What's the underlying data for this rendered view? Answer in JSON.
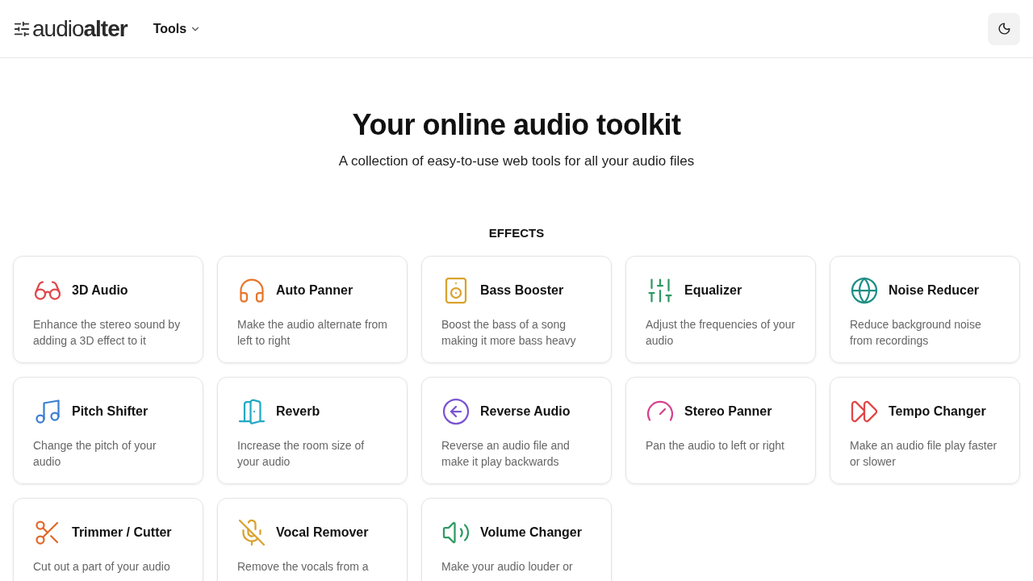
{
  "header": {
    "logo": {
      "light": "audio",
      "bold": "alter"
    },
    "nav": [
      {
        "label": "Tools",
        "expanded": false
      }
    ]
  },
  "hero": {
    "title": "Your online audio toolkit",
    "subtitle": "A collection of easy-to-use web tools for all your audio files"
  },
  "section": {
    "title": "EFFECTS",
    "tools": [
      {
        "color": "#e0474c",
        "name": "3D Audio",
        "description": "Enhance the stereo sound by adding a 3D effect to it"
      },
      {
        "color": "#e8752a",
        "name": "Auto Panner",
        "description": "Make the audio alternate from left to right"
      },
      {
        "color": "#d9a22e",
        "name": "Bass Booster",
        "description": "Boost the bass of a song making it more bass heavy"
      },
      {
        "color": "#2e9a63",
        "name": "Equalizer",
        "description": "Adjust the frequencies of your audio"
      },
      {
        "color": "#1f8f86",
        "name": "Noise Reducer",
        "description": "Reduce background noise from recordings"
      },
      {
        "color": "#3b7fd1",
        "name": "Pitch Shifter",
        "description": "Change the pitch of your audio"
      },
      {
        "color": "#22a9c4",
        "name": "Reverb",
        "description": "Increase the room size of your audio"
      },
      {
        "color": "#7b55cf",
        "name": "Reverse Audio",
        "description": "Reverse an audio file and make it play backwards"
      },
      {
        "color": "#d6408f",
        "name": "Stereo Panner",
        "description": "Pan the audio to left or right"
      },
      {
        "color": "#e04646",
        "name": "Tempo Changer",
        "description": "Make an audio file play faster or slower"
      },
      {
        "color": "#e0692a",
        "name": "Trimmer / Cutter",
        "description": "Cut out a part of your audio"
      },
      {
        "color": "#d9a22e",
        "name": "Vocal Remover",
        "description": "Remove the vocals from a"
      },
      {
        "color": "#2e9a63",
        "name": "Volume Changer",
        "description": "Make your audio louder or"
      }
    ]
  }
}
